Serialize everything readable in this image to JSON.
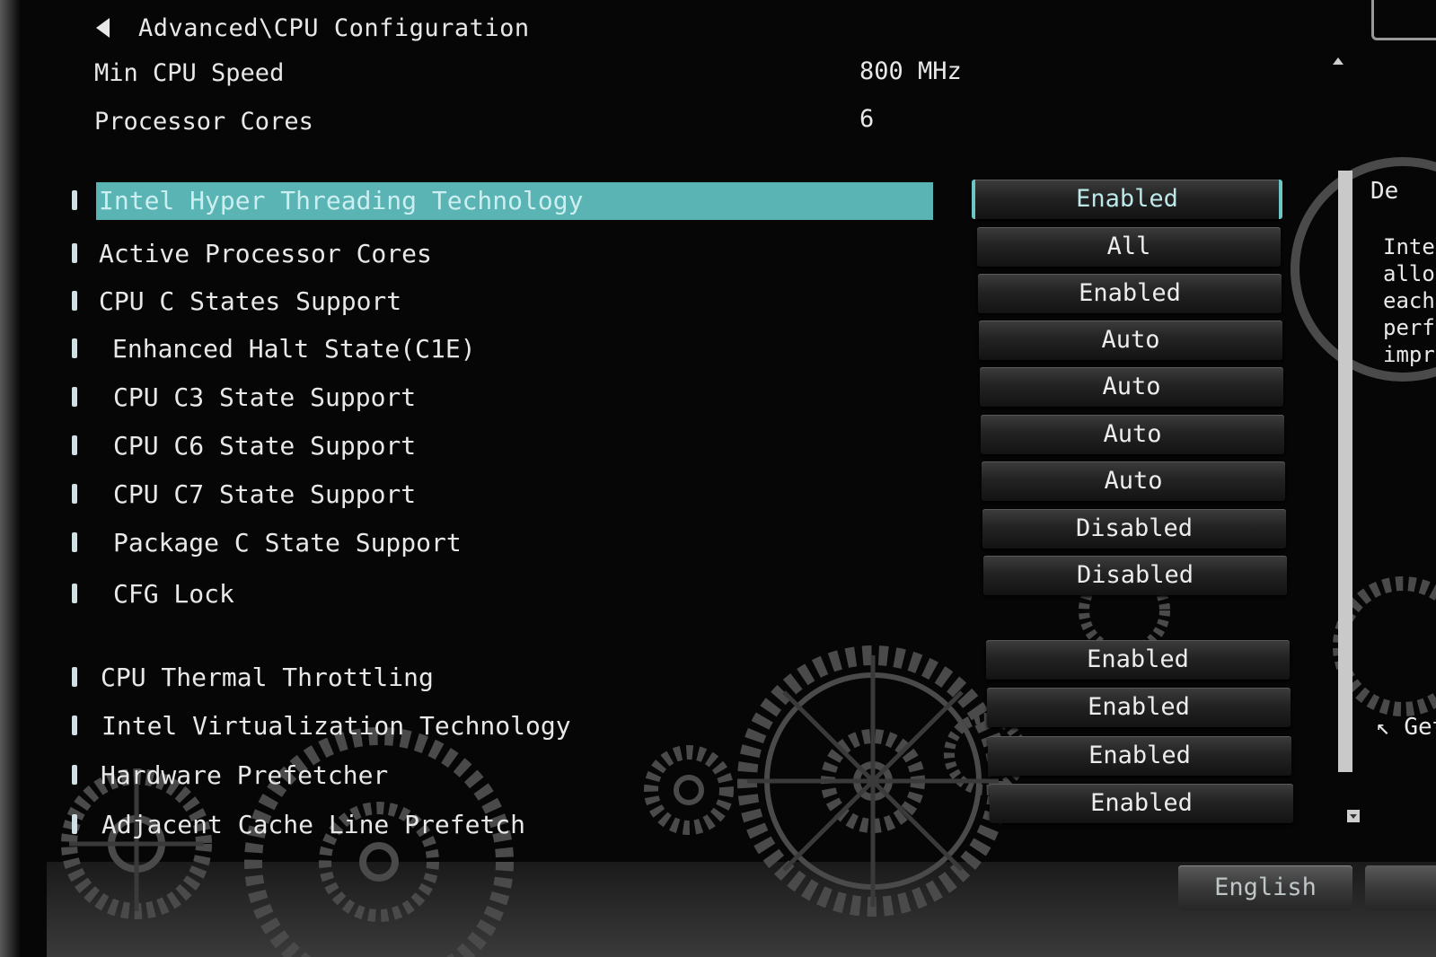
{
  "header": {
    "breadcrumb": "Advanced\\CPU Configuration"
  },
  "info": [
    {
      "label": "Min CPU Speed",
      "value": "800 MHz"
    },
    {
      "label": "Processor Cores",
      "value": "6"
    }
  ],
  "items": [
    {
      "label": "Intel Hyper Threading Technology",
      "value": "Enabled"
    },
    {
      "label": "Active Processor Cores",
      "value": "All"
    },
    {
      "label": "CPU C States Support",
      "value": "Enabled"
    },
    {
      "label": "Enhanced Halt State(C1E)",
      "value": "Auto"
    },
    {
      "label": "CPU C3 State Support",
      "value": "Auto"
    },
    {
      "label": "CPU C6 State Support",
      "value": "Auto"
    },
    {
      "label": "CPU C7 State Support",
      "value": "Auto"
    },
    {
      "label": "Package C State Support",
      "value": "Disabled"
    },
    {
      "label": "CFG Lock",
      "value": "Disabled"
    },
    {
      "label": "CPU Thermal Throttling",
      "value": "Enabled"
    },
    {
      "label": "Intel Virtualization Technology",
      "value": "Enabled"
    },
    {
      "label": "Hardware Prefetcher",
      "value": "Enabled"
    },
    {
      "label": "Adjacent Cache Line Prefetch",
      "value": "Enabled"
    }
  ],
  "right_panel": {
    "heading": "De",
    "lines": [
      "Inte",
      "allo",
      "each",
      "perf",
      "impr"
    ],
    "link": "Get"
  },
  "footer": {
    "language": "English"
  },
  "colors": {
    "highlight": "#5ab4b4",
    "accent": "#6cc6c6",
    "background": "#060606"
  },
  "icons": {
    "back": "back-arrow-icon",
    "cursor": "mouse-pointer-icon"
  }
}
